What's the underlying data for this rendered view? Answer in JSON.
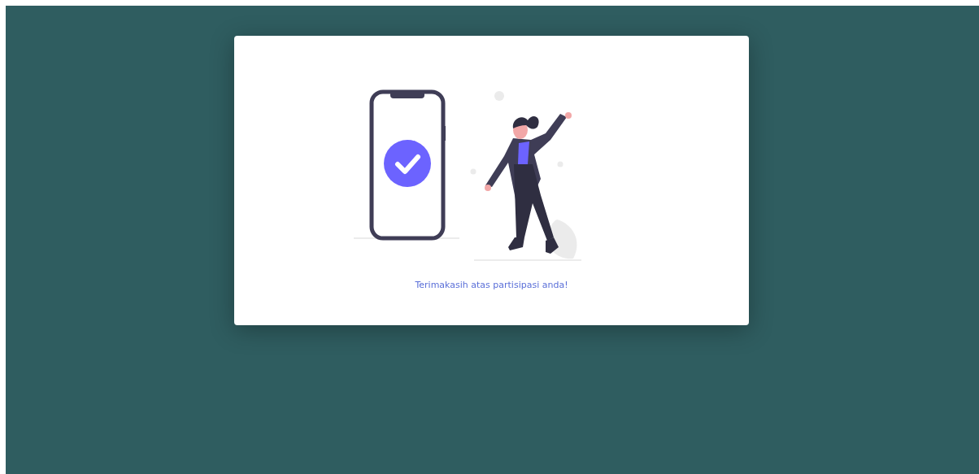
{
  "card": {
    "message": "Terimakasih atas partisipasi anda!"
  }
}
